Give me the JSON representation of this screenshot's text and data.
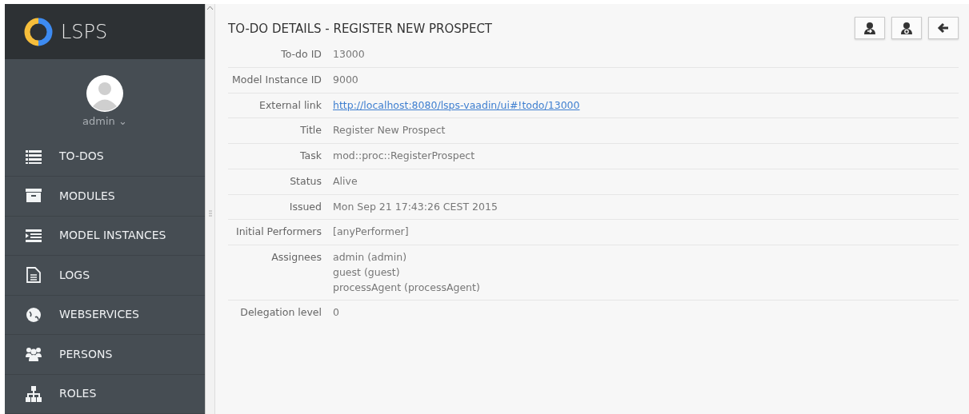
{
  "app": {
    "name": "LSPS"
  },
  "user": {
    "name": "admin",
    "caret": "⌄"
  },
  "sidebar": {
    "items": [
      {
        "label": "TO-DOS"
      },
      {
        "label": "MODULES"
      },
      {
        "label": "MODEL INSTANCES"
      },
      {
        "label": "LOGS"
      },
      {
        "label": "WEBSERVICES"
      },
      {
        "label": "PERSONS"
      },
      {
        "label": "ROLES"
      }
    ]
  },
  "details": {
    "title": "TO-DO DETAILS - REGISTER NEW PROSPECT",
    "rows": [
      {
        "label": "To-do ID",
        "kind": "text",
        "values": [
          "13000"
        ]
      },
      {
        "label": "Model Instance ID",
        "kind": "text",
        "values": [
          "9000"
        ]
      },
      {
        "label": "External link",
        "kind": "link",
        "values": [
          "http://localhost:8080/lsps-vaadin/ui#!todo/13000"
        ]
      },
      {
        "label": "Title",
        "kind": "text",
        "values": [
          "Register New Prospect"
        ]
      },
      {
        "label": "Task",
        "kind": "text",
        "values": [
          "mod::proc::RegisterProspect"
        ]
      },
      {
        "label": "Status",
        "kind": "text",
        "values": [
          "Alive"
        ]
      },
      {
        "label": "Issued",
        "kind": "text",
        "values": [
          "Mon Sep 21 17:43:26 CEST 2015"
        ]
      },
      {
        "label": "Initial Performers",
        "kind": "text",
        "values": [
          "[anyPerformer]"
        ]
      },
      {
        "label": "Assignees",
        "kind": "text",
        "values": [
          "admin (admin)",
          "guest (guest)",
          "processAgent (processAgent)"
        ]
      },
      {
        "label": "Delegation level",
        "kind": "text",
        "values": [
          "0"
        ]
      }
    ]
  }
}
